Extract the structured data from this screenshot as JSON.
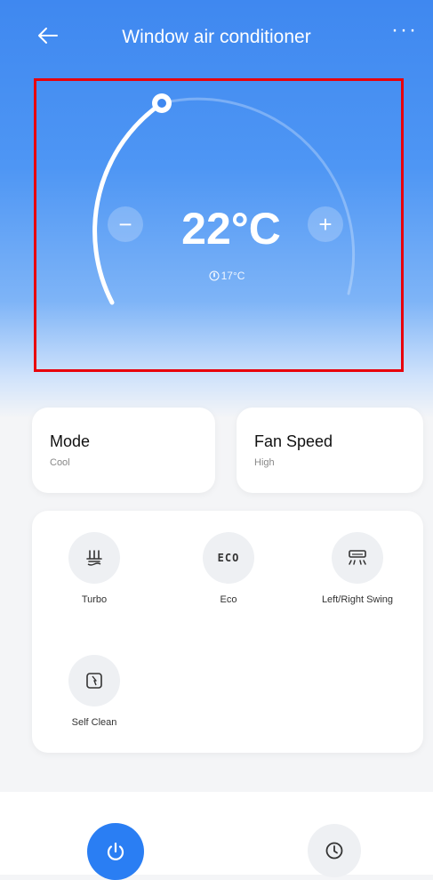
{
  "header": {
    "title": "Window air conditioner",
    "back_icon": "arrow-left-icon",
    "more_label": "···"
  },
  "thermostat": {
    "set_temperature": "22°C",
    "minus_label": "−",
    "plus_label": "+",
    "indoor_temperature": "17°C",
    "indoor_icon": "indoor-temp-icon"
  },
  "cards": {
    "mode": {
      "title": "Mode",
      "value": "Cool"
    },
    "fan_speed": {
      "title": "Fan Speed",
      "value": "High"
    }
  },
  "functions": [
    {
      "label": "Turbo",
      "icon": "turbo-icon"
    },
    {
      "label": "Eco",
      "icon": "eco-icon",
      "icon_text": "ECO"
    },
    {
      "label": "Left/Right Swing",
      "icon": "swing-icon"
    },
    {
      "label": "Self Clean",
      "icon": "self-clean-icon"
    }
  ],
  "bottom": {
    "power_icon": "power-icon",
    "timer_icon": "clock-icon"
  },
  "colors": {
    "accent": "#2a7ef3",
    "header_blue": "#3f88f0",
    "highlight": "#e8000b"
  }
}
